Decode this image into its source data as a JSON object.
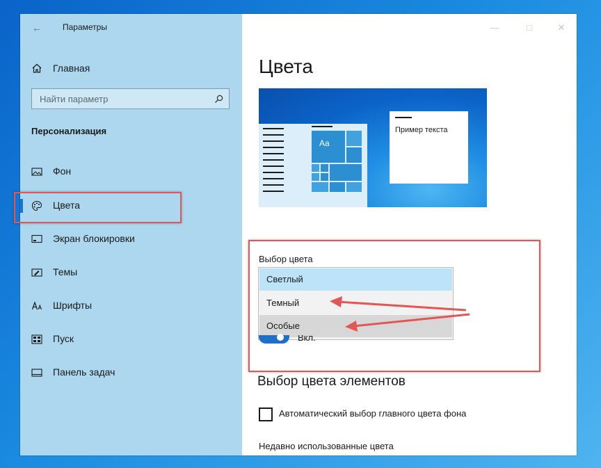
{
  "window": {
    "title": "Параметры",
    "back_icon": "back-arrow-icon",
    "controls": [
      "minimize-icon",
      "maximize-icon",
      "close-icon"
    ]
  },
  "sidebar": {
    "home_label": "Главная",
    "search_placeholder": "Найти параметр",
    "section_title": "Персонализация",
    "items": [
      {
        "label": "Фон",
        "icon": "picture-icon"
      },
      {
        "label": "Цвета",
        "icon": "palette-icon",
        "selected": true
      },
      {
        "label": "Экран блокировки",
        "icon": "lock-screen-icon"
      },
      {
        "label": "Темы",
        "icon": "themes-icon"
      },
      {
        "label": "Шрифты",
        "icon": "fonts-icon"
      },
      {
        "label": "Пуск",
        "icon": "start-icon"
      },
      {
        "label": "Панель задач",
        "icon": "taskbar-icon"
      }
    ]
  },
  "main": {
    "title": "Цвета",
    "preview": {
      "sample_text": "Пример текста",
      "tile_text": "Aa"
    },
    "color_choice": {
      "label": "Выбор цвета",
      "options": [
        "Светлый",
        "Темный",
        "Особые"
      ],
      "highlighted_index": 0,
      "hover_index": 2
    },
    "toggle_state_label": "Вкл.",
    "accent_title": "Выбор цвета элементов",
    "auto_accent_label": "Автоматический выбор главного цвета фона",
    "recent_colors_label": "Недавно использованные цвета"
  },
  "colors": {
    "accent": "#1976d2",
    "sidebar_bg": "#acd7ee",
    "annotation": "#e35656",
    "option_selected": "#bde3f8",
    "option_hover": "#d7d7d7"
  }
}
